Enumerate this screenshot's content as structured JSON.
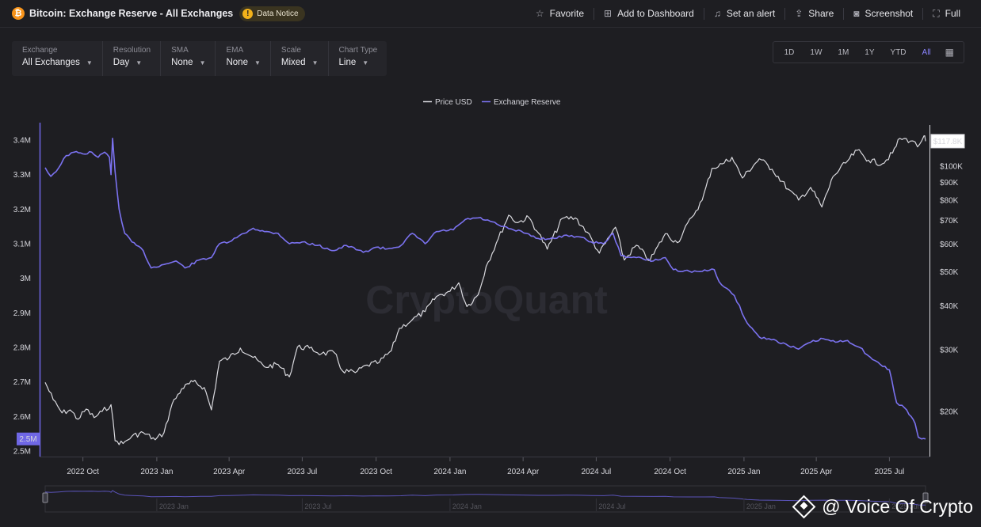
{
  "header": {
    "title": "Bitcoin: Exchange Reserve - All Exchanges",
    "notice_label": "Data Notice",
    "actions": [
      {
        "label": "Favorite",
        "icon": "star-icon"
      },
      {
        "label": "Add to Dashboard",
        "icon": "dashboard-add-icon"
      },
      {
        "label": "Set an alert",
        "icon": "bell-icon"
      },
      {
        "label": "Share",
        "icon": "share-icon"
      },
      {
        "label": "Screenshot",
        "icon": "camera-icon"
      },
      {
        "label": "Full",
        "icon": "fullscreen-icon"
      }
    ]
  },
  "controls": [
    {
      "label": "Exchange",
      "value": "All Exchanges"
    },
    {
      "label": "Resolution",
      "value": "Day"
    },
    {
      "label": "SMA",
      "value": "None"
    },
    {
      "label": "EMA",
      "value": "None"
    },
    {
      "label": "Scale",
      "value": "Mixed"
    },
    {
      "label": "Chart Type",
      "value": "Line"
    }
  ],
  "ranges": {
    "items": [
      "1D",
      "1W",
      "1M",
      "1Y",
      "YTD",
      "All"
    ],
    "active": "All"
  },
  "watermark": "CryptoQuant",
  "credit": "@ Voice Of Crypto",
  "colors": {
    "price": "#d9d9de",
    "reserve": "#7b72f0",
    "background": "#1e1e22"
  },
  "chart_data": {
    "type": "line",
    "legend_position": "top-center",
    "grid": false,
    "x_ticks": [
      "2022 Oct",
      "2023 Jan",
      "2023 Apr",
      "2023 Jul",
      "2023 Oct",
      "2024 Jan",
      "2024 Apr",
      "2024 Jul",
      "2024 Oct",
      "2025 Jan",
      "2025 Apr",
      "2025 Jul"
    ],
    "left_ticks": [
      "3.4M",
      "3.3M",
      "3.2M",
      "3.1M",
      "3M",
      "2.9M",
      "2.8M",
      "2.7M",
      "2.6M",
      "2.5M"
    ],
    "left_range": [
      2500000,
      3400000
    ],
    "right_ticks": [
      "$100K",
      "$90K",
      "$80K",
      "$70K",
      "$60K",
      "$50K",
      "$40K",
      "$30K",
      "$20K"
    ],
    "right_scale": "log",
    "right_range": [
      15500,
      125000
    ],
    "left_current_label": "2.5M",
    "right_current_label": "$117.8K",
    "navigator_ticks": [
      "2023 Jan",
      "2023 Jul",
      "2024 Jan",
      "2024 Jul",
      "2025 Jan",
      "2025 Jul"
    ],
    "x_start": "2022-08-15",
    "x_end": "2025-08-15",
    "series": [
      {
        "name": "Price USD",
        "axis": "right",
        "points": [
          [
            "2022-08-15",
            24200
          ],
          [
            "2022-08-25",
            21600
          ],
          [
            "2022-09-05",
            19800
          ],
          [
            "2022-09-15",
            20200
          ],
          [
            "2022-09-25",
            19000
          ],
          [
            "2022-10-05",
            20300
          ],
          [
            "2022-10-15",
            19200
          ],
          [
            "2022-10-25",
            20000
          ],
          [
            "2022-11-05",
            20900
          ],
          [
            "2022-11-10",
            16500
          ],
          [
            "2022-11-20",
            16200
          ],
          [
            "2022-12-01",
            17000
          ],
          [
            "2022-12-15",
            17400
          ],
          [
            "2022-12-30",
            16600
          ],
          [
            "2023-01-10",
            17400
          ],
          [
            "2023-01-20",
            21000
          ],
          [
            "2023-02-01",
            23200
          ],
          [
            "2023-02-15",
            24300
          ],
          [
            "2023-03-01",
            23400
          ],
          [
            "2023-03-10",
            20200
          ],
          [
            "2023-03-20",
            27800
          ],
          [
            "2023-04-01",
            28400
          ],
          [
            "2023-04-15",
            30300
          ],
          [
            "2023-05-01",
            28500
          ],
          [
            "2023-05-15",
            26800
          ],
          [
            "2023-06-01",
            27200
          ],
          [
            "2023-06-15",
            25100
          ],
          [
            "2023-06-25",
            30500
          ],
          [
            "2023-07-10",
            30300
          ],
          [
            "2023-07-25",
            29200
          ],
          [
            "2023-08-10",
            29400
          ],
          [
            "2023-08-20",
            26100
          ],
          [
            "2023-09-05",
            25800
          ],
          [
            "2023-09-20",
            27100
          ],
          [
            "2023-10-05",
            27600
          ],
          [
            "2023-10-20",
            29800
          ],
          [
            "2023-10-30",
            34500
          ],
          [
            "2023-11-15",
            36500
          ],
          [
            "2023-12-01",
            38500
          ],
          [
            "2023-12-15",
            42500
          ],
          [
            "2024-01-01",
            44000
          ],
          [
            "2024-01-12",
            46500
          ],
          [
            "2024-01-22",
            39800
          ],
          [
            "2024-02-05",
            43000
          ],
          [
            "2024-02-15",
            51800
          ],
          [
            "2024-03-01",
            62000
          ],
          [
            "2024-03-14",
            72500
          ],
          [
            "2024-03-25",
            69000
          ],
          [
            "2024-04-08",
            71500
          ],
          [
            "2024-04-20",
            64500
          ],
          [
            "2024-05-01",
            58000
          ],
          [
            "2024-05-20",
            71000
          ],
          [
            "2024-06-05",
            71200
          ],
          [
            "2024-06-20",
            64800
          ],
          [
            "2024-07-05",
            56500
          ],
          [
            "2024-07-25",
            67000
          ],
          [
            "2024-08-05",
            54000
          ],
          [
            "2024-08-20",
            59500
          ],
          [
            "2024-09-06",
            53800
          ],
          [
            "2024-09-25",
            64200
          ],
          [
            "2024-10-10",
            60500
          ],
          [
            "2024-10-28",
            71500
          ],
          [
            "2024-11-10",
            80000
          ],
          [
            "2024-11-22",
            98500
          ],
          [
            "2024-12-05",
            101500
          ],
          [
            "2024-12-17",
            106000
          ],
          [
            "2024-12-30",
            92500
          ],
          [
            "2025-01-20",
            105000
          ],
          [
            "2025-02-05",
            98000
          ],
          [
            "2025-02-25",
            86000
          ],
          [
            "2025-03-10",
            80000
          ],
          [
            "2025-03-25",
            87000
          ],
          [
            "2025-04-08",
            76500
          ],
          [
            "2025-04-22",
            93500
          ],
          [
            "2025-05-10",
            103500
          ],
          [
            "2025-05-22",
            111000
          ],
          [
            "2025-06-05",
            104000
          ],
          [
            "2025-06-22",
            101500
          ],
          [
            "2025-07-05",
            109000
          ],
          [
            "2025-07-14",
            120000
          ],
          [
            "2025-07-30",
            118000
          ],
          [
            "2025-08-05",
            113500
          ],
          [
            "2025-08-13",
            122000
          ],
          [
            "2025-08-15",
            117800
          ]
        ]
      },
      {
        "name": "Exchange Reserve",
        "axis": "left",
        "points": [
          [
            "2022-08-15",
            3320000
          ],
          [
            "2022-08-22",
            3295000
          ],
          [
            "2022-09-01",
            3320000
          ],
          [
            "2022-09-10",
            3355000
          ],
          [
            "2022-09-20",
            3365000
          ],
          [
            "2022-10-01",
            3360000
          ],
          [
            "2022-10-12",
            3365000
          ],
          [
            "2022-10-20",
            3350000
          ],
          [
            "2022-10-28",
            3365000
          ],
          [
            "2022-11-03",
            3350000
          ],
          [
            "2022-11-05",
            3300000
          ],
          [
            "2022-11-07",
            3405000
          ],
          [
            "2022-11-10",
            3310000
          ],
          [
            "2022-11-15",
            3200000
          ],
          [
            "2022-11-22",
            3130000
          ],
          [
            "2022-12-01",
            3105000
          ],
          [
            "2022-12-15",
            3080000
          ],
          [
            "2022-12-25",
            3030000
          ],
          [
            "2023-01-10",
            3040000
          ],
          [
            "2023-01-25",
            3050000
          ],
          [
            "2023-02-05",
            3030000
          ],
          [
            "2023-02-25",
            3055000
          ],
          [
            "2023-03-10",
            3060000
          ],
          [
            "2023-03-20",
            3100000
          ],
          [
            "2023-04-01",
            3105000
          ],
          [
            "2023-04-20",
            3130000
          ],
          [
            "2023-05-01",
            3145000
          ],
          [
            "2023-05-15",
            3135000
          ],
          [
            "2023-06-01",
            3130000
          ],
          [
            "2023-06-15",
            3100000
          ],
          [
            "2023-07-01",
            3105000
          ],
          [
            "2023-07-20",
            3095000
          ],
          [
            "2023-08-10",
            3080000
          ],
          [
            "2023-08-25",
            3095000
          ],
          [
            "2023-09-15",
            3075000
          ],
          [
            "2023-10-01",
            3090000
          ],
          [
            "2023-10-15",
            3085000
          ],
          [
            "2023-11-01",
            3095000
          ],
          [
            "2023-11-15",
            3130000
          ],
          [
            "2023-12-01",
            3100000
          ],
          [
            "2023-12-15",
            3135000
          ],
          [
            "2024-01-05",
            3140000
          ],
          [
            "2024-01-20",
            3170000
          ],
          [
            "2024-02-05",
            3175000
          ],
          [
            "2024-02-20",
            3165000
          ],
          [
            "2024-03-05",
            3150000
          ],
          [
            "2024-03-20",
            3140000
          ],
          [
            "2024-04-05",
            3130000
          ],
          [
            "2024-04-20",
            3115000
          ],
          [
            "2024-05-10",
            3115000
          ],
          [
            "2024-05-25",
            3125000
          ],
          [
            "2024-06-10",
            3120000
          ],
          [
            "2024-06-25",
            3105000
          ],
          [
            "2024-07-10",
            3100000
          ],
          [
            "2024-07-22",
            3130000
          ],
          [
            "2024-08-01",
            3065000
          ],
          [
            "2024-08-20",
            3060000
          ],
          [
            "2024-09-10",
            3050000
          ],
          [
            "2024-09-25",
            3060000
          ],
          [
            "2024-10-05",
            3025000
          ],
          [
            "2024-10-25",
            3020000
          ],
          [
            "2024-11-10",
            3020000
          ],
          [
            "2024-11-25",
            3025000
          ],
          [
            "2024-12-01",
            2990000
          ],
          [
            "2024-12-20",
            2950000
          ],
          [
            "2025-01-05",
            2870000
          ],
          [
            "2025-01-20",
            2830000
          ],
          [
            "2025-02-10",
            2820000
          ],
          [
            "2025-02-25",
            2805000
          ],
          [
            "2025-03-10",
            2795000
          ],
          [
            "2025-03-25",
            2815000
          ],
          [
            "2025-04-10",
            2825000
          ],
          [
            "2025-04-25",
            2815000
          ],
          [
            "2025-05-10",
            2820000
          ],
          [
            "2025-05-25",
            2800000
          ],
          [
            "2025-06-10",
            2765000
          ],
          [
            "2025-06-20",
            2750000
          ],
          [
            "2025-07-01",
            2735000
          ],
          [
            "2025-07-10",
            2640000
          ],
          [
            "2025-07-20",
            2625000
          ],
          [
            "2025-07-28",
            2600000
          ],
          [
            "2025-08-02",
            2580000
          ],
          [
            "2025-08-06",
            2540000
          ],
          [
            "2025-08-10",
            2535000
          ],
          [
            "2025-08-15",
            2535000
          ]
        ]
      }
    ]
  }
}
